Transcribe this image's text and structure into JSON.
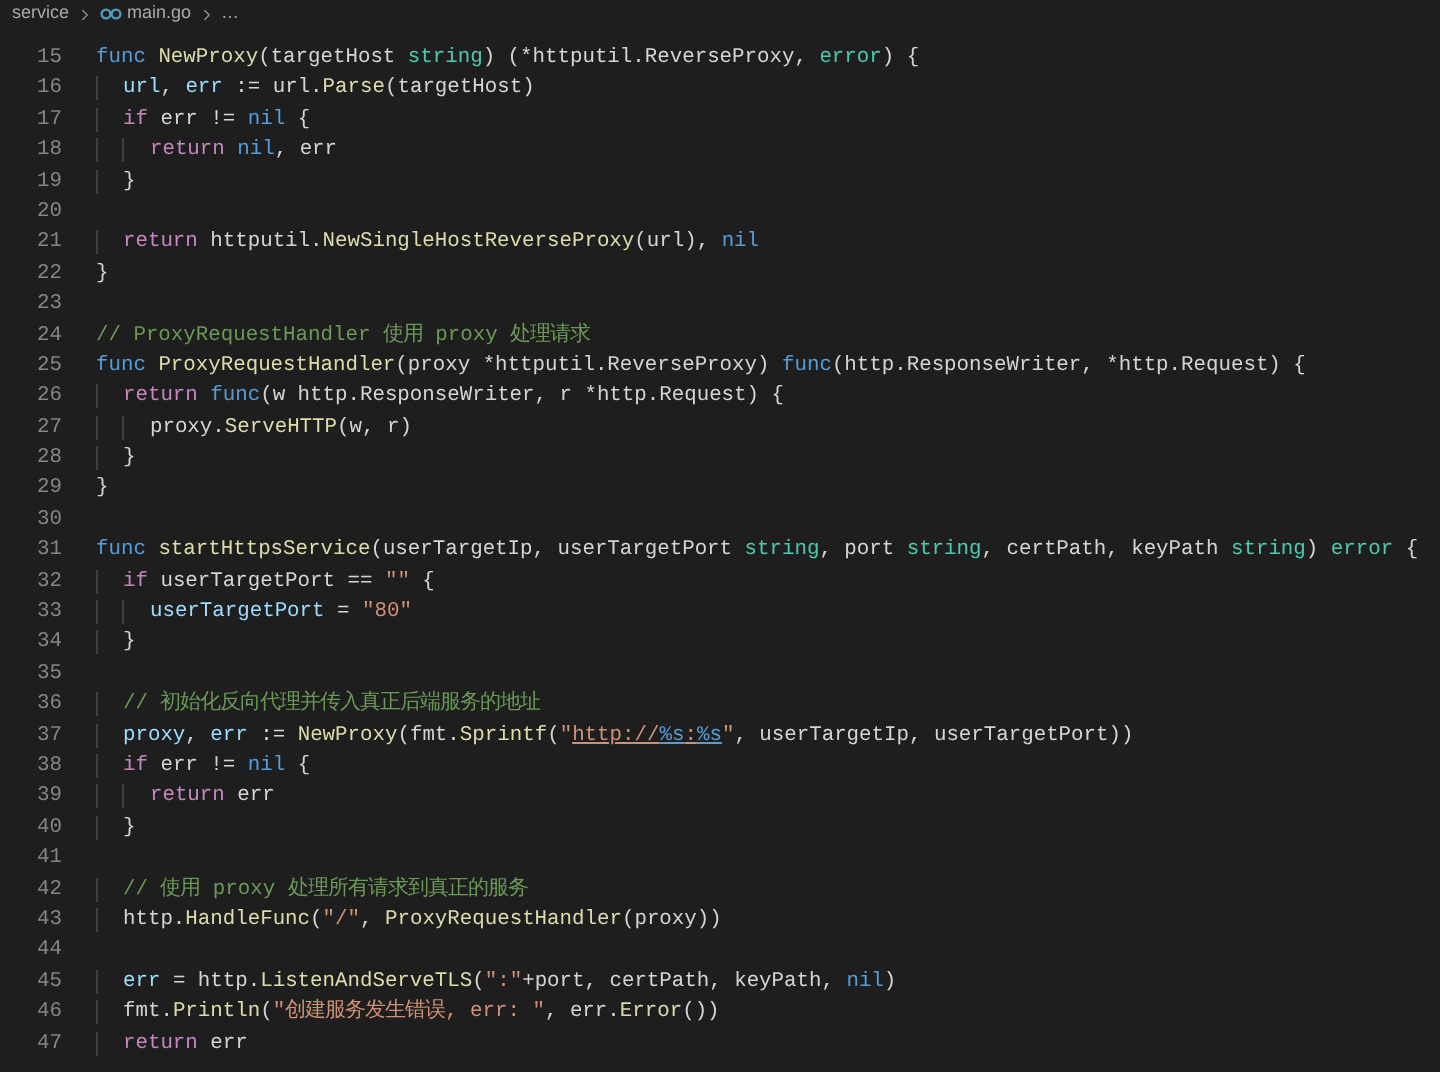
{
  "breadcrumb": [
    {
      "label": "service",
      "kind": "folder"
    },
    {
      "label": "main.go",
      "kind": "file"
    },
    {
      "label": "…",
      "kind": "more"
    }
  ],
  "lines": [
    {
      "number": "15",
      "tokens": [
        {
          "text": "func",
          "kind": "keyword"
        },
        {
          "text": " NewProxy",
          "kind": "function"
        },
        {
          "text": "(targetHost ",
          "kind": "plain"
        },
        {
          "text": "string",
          "kind": "type"
        },
        {
          "text": ") (*httputil.ReverseProxy, ",
          "kind": "plain"
        },
        {
          "text": "error",
          "kind": "type"
        },
        {
          "text": ") {",
          "kind": "plain"
        }
      ]
    },
    {
      "number": "16",
      "tokens": [
        {
          "text": "  url",
          "kind": "variable"
        },
        {
          "text": ", ",
          "kind": "plain"
        },
        {
          "text": "err",
          "kind": "variable"
        },
        {
          "text": " := url.",
          "kind": "plain"
        },
        {
          "text": "Parse",
          "kind": "function"
        },
        {
          "text": "(targetHost)",
          "kind": "plain"
        }
      ]
    },
    {
      "number": "17",
      "tokens": [
        {
          "text": "  if",
          "kind": "control"
        },
        {
          "text": " err != ",
          "kind": "plain"
        },
        {
          "text": "nil",
          "kind": "constant"
        },
        {
          "text": " {",
          "kind": "plain"
        }
      ]
    },
    {
      "number": "18",
      "tokens": [
        {
          "text": "    return",
          "kind": "control"
        },
        {
          "text": " nil",
          "kind": "constant"
        },
        {
          "text": ", err",
          "kind": "plain"
        }
      ]
    },
    {
      "number": "19",
      "tokens": [
        {
          "text": "  }",
          "kind": "plain"
        }
      ]
    },
    {
      "number": "20"
    },
    {
      "number": "21",
      "tokens": [
        {
          "text": "  return",
          "kind": "control"
        },
        {
          "text": " httputil.",
          "kind": "plain"
        },
        {
          "text": "NewSingleHostReverseProxy",
          "kind": "function"
        },
        {
          "text": "(url), ",
          "kind": "plain"
        },
        {
          "text": "nil",
          "kind": "constant"
        }
      ]
    },
    {
      "number": "22",
      "tokens": [
        {
          "text": "}",
          "kind": "plain"
        }
      ]
    },
    {
      "number": "23"
    },
    {
      "number": "24",
      "tokens": [
        {
          "text": "// ProxyRequestHandler 使用 proxy 处理请求",
          "kind": "comment"
        }
      ]
    },
    {
      "number": "25",
      "tokens": [
        {
          "text": "func",
          "kind": "keyword"
        },
        {
          "text": " ProxyRequestHandler",
          "kind": "function"
        },
        {
          "text": "(proxy *httputil.ReverseProxy) ",
          "kind": "plain"
        },
        {
          "text": "func",
          "kind": "keyword"
        },
        {
          "text": "(http.ResponseWriter, *http.Request) {",
          "kind": "plain"
        }
      ]
    },
    {
      "number": "26",
      "tokens": [
        {
          "text": "  return",
          "kind": "control"
        },
        {
          "text": " func",
          "kind": "keyword"
        },
        {
          "text": "(w http.ResponseWriter, r *http.Request) {",
          "kind": "plain"
        }
      ]
    },
    {
      "number": "27",
      "tokens": [
        {
          "text": "    proxy.",
          "kind": "plain"
        },
        {
          "text": "ServeHTTP",
          "kind": "function"
        },
        {
          "text": "(w, r)",
          "kind": "plain"
        }
      ]
    },
    {
      "number": "28",
      "tokens": [
        {
          "text": "  }",
          "kind": "plain"
        }
      ]
    },
    {
      "number": "29",
      "tokens": [
        {
          "text": "}",
          "kind": "plain"
        }
      ]
    },
    {
      "number": "30"
    },
    {
      "number": "31",
      "tokens": [
        {
          "text": "func",
          "kind": "keyword"
        },
        {
          "text": " startHttpsService",
          "kind": "function"
        },
        {
          "text": "(userTargetIp, userTargetPort ",
          "kind": "plain"
        },
        {
          "text": "string",
          "kind": "type"
        },
        {
          "text": ", port ",
          "kind": "plain"
        },
        {
          "text": "string",
          "kind": "type"
        },
        {
          "text": ", certPath, keyPath ",
          "kind": "plain"
        },
        {
          "text": "string",
          "kind": "type"
        },
        {
          "text": ") ",
          "kind": "plain"
        },
        {
          "text": "error",
          "kind": "type"
        },
        {
          "text": " {",
          "kind": "plain"
        }
      ]
    },
    {
      "number": "32",
      "tokens": [
        {
          "text": "  if",
          "kind": "control"
        },
        {
          "text": " userTargetPort == ",
          "kind": "plain"
        },
        {
          "text": "\"\"",
          "kind": "string"
        },
        {
          "text": " {",
          "kind": "plain"
        }
      ]
    },
    {
      "number": "33",
      "tokens": [
        {
          "text": "    userTargetPort",
          "kind": "variable"
        },
        {
          "text": " = ",
          "kind": "plain"
        },
        {
          "text": "\"80\"",
          "kind": "string"
        }
      ]
    },
    {
      "number": "34",
      "tokens": [
        {
          "text": "  }",
          "kind": "plain"
        }
      ]
    },
    {
      "number": "35"
    },
    {
      "number": "36",
      "tokens": [
        {
          "text": "  // 初始化反向代理并传入真正后端服务的地址",
          "kind": "comment"
        }
      ]
    },
    {
      "number": "37",
      "tokens": [
        {
          "text": "  proxy",
          "kind": "variable"
        },
        {
          "text": ", ",
          "kind": "plain"
        },
        {
          "text": "err",
          "kind": "variable"
        },
        {
          "text": " := ",
          "kind": "plain"
        },
        {
          "text": "NewProxy",
          "kind": "function"
        },
        {
          "text": "(fmt.",
          "kind": "plain"
        },
        {
          "text": "Sprintf",
          "kind": "function"
        },
        {
          "text": "(",
          "kind": "plain"
        },
        {
          "text": "\"",
          "kind": "string"
        },
        {
          "text": "http://",
          "kind": "link"
        },
        {
          "text": "%s",
          "kind": "link-format"
        },
        {
          "text": ":",
          "kind": "link"
        },
        {
          "text": "%s",
          "kind": "link-format"
        },
        {
          "text": "\"",
          "kind": "string"
        },
        {
          "text": ", userTargetIp, userTargetPort))",
          "kind": "plain"
        }
      ]
    },
    {
      "number": "38",
      "tokens": [
        {
          "text": "  if",
          "kind": "control"
        },
        {
          "text": " err != ",
          "kind": "plain"
        },
        {
          "text": "nil",
          "kind": "constant"
        },
        {
          "text": " {",
          "kind": "plain"
        }
      ]
    },
    {
      "number": "39",
      "tokens": [
        {
          "text": "    return",
          "kind": "control"
        },
        {
          "text": " err",
          "kind": "plain"
        }
      ]
    },
    {
      "number": "40",
      "tokens": [
        {
          "text": "  }",
          "kind": "plain"
        }
      ]
    },
    {
      "number": "41"
    },
    {
      "number": "42",
      "tokens": [
        {
          "text": "  // 使用 proxy 处理所有请求到真正的服务",
          "kind": "comment"
        }
      ]
    },
    {
      "number": "43",
      "tokens": [
        {
          "text": "  http.",
          "kind": "plain"
        },
        {
          "text": "HandleFunc",
          "kind": "function"
        },
        {
          "text": "(",
          "kind": "plain"
        },
        {
          "text": "\"/\"",
          "kind": "string"
        },
        {
          "text": ", ",
          "kind": "plain"
        },
        {
          "text": "ProxyRequestHandler",
          "kind": "function"
        },
        {
          "text": "(proxy))",
          "kind": "plain"
        }
      ]
    },
    {
      "number": "44"
    },
    {
      "number": "45",
      "tokens": [
        {
          "text": "  err",
          "kind": "variable"
        },
        {
          "text": " = http.",
          "kind": "plain"
        },
        {
          "text": "ListenAndServeTLS",
          "kind": "function"
        },
        {
          "text": "(",
          "kind": "plain"
        },
        {
          "text": "\":\"",
          "kind": "string"
        },
        {
          "text": "+port, certPath, keyPath, ",
          "kind": "plain"
        },
        {
          "text": "nil",
          "kind": "constant"
        },
        {
          "text": ")",
          "kind": "plain"
        }
      ]
    },
    {
      "number": "46",
      "tokens": [
        {
          "text": "  fmt.",
          "kind": "plain"
        },
        {
          "text": "Println",
          "kind": "function"
        },
        {
          "text": "(",
          "kind": "plain"
        },
        {
          "text": "\"创建服务发生错误, err: \"",
          "kind": "string"
        },
        {
          "text": ", err.",
          "kind": "plain"
        },
        {
          "text": "Error",
          "kind": "function"
        },
        {
          "text": "())",
          "kind": "plain"
        }
      ]
    },
    {
      "number": "47",
      "tokens": [
        {
          "text": "  return",
          "kind": "control"
        },
        {
          "text": " err",
          "kind": "plain"
        }
      ]
    }
  ]
}
